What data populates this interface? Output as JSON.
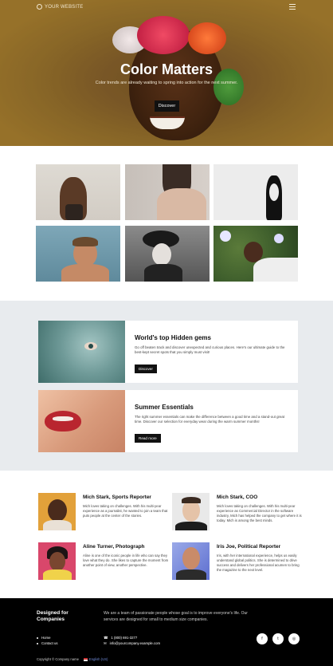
{
  "nav": {
    "logo_text": "YOUR WEBSITE"
  },
  "hero": {
    "title": "Color Matters",
    "subtitle": "Color trends are already waiting to spring into action for the next summer.",
    "cta": "Discover"
  },
  "gallery": {
    "photos": [
      "woman-portrait",
      "back-portrait",
      "dancer-illustration",
      "man-by-water",
      "woman-with-hat",
      "woman-in-flowers"
    ]
  },
  "features": [
    {
      "title": "World's top Hidden gems",
      "text": "Go off beaten track and discover unexpected and curious places. Here's our ultimate guide to the best-kept secret spots that you simply must visit!",
      "button": "Discover"
    },
    {
      "title": "Summer Essentials",
      "text": "The right summer essentials can make the difference between a good time and a stand-out great time. Discover our selection for everyday wear during the warm summer months!",
      "button": "Read more"
    }
  ],
  "team": [
    {
      "name": "Mich Stark, Sports Reporter",
      "bio": "Mich loves taking on challenges. With his multi-year experience as a journalist, he wanted to join a team that puts people at the center of the stories."
    },
    {
      "name": "Mich Stark, COO",
      "bio": "Mich loves taking on challenges. With his multi-year experience as Commercial Director in the software industry, Mich has helped the company to get where it is today. Mich is among the best minds."
    },
    {
      "name": "Aline Turner, Photograph",
      "bio": "Aline is one of the iconic people in life who can say they love what they do. She likes to capture the moment from another point of view, another perspective."
    },
    {
      "name": "Iris Joe, Political Reporter",
      "bio": "Iris, with her international experience, helps us easily understand global politics. She is determined to drive success and delivers her professional acumen to bring the magazine to the next level."
    }
  ],
  "footer": {
    "title": "Designed for Companies",
    "description": "We are a team of passionate people whose goal is to improve everyone's life. Our services are designed for small to medium size companies.",
    "links": [
      "Home",
      "Contact us"
    ],
    "phone": "1 (800) 691-3277",
    "email": "info@yourcompany.example.com",
    "socials": [
      "facebook-icon",
      "twitter-icon",
      "instagram-icon"
    ],
    "copyright": "Copyright © Company name",
    "language": "English (US)"
  }
}
